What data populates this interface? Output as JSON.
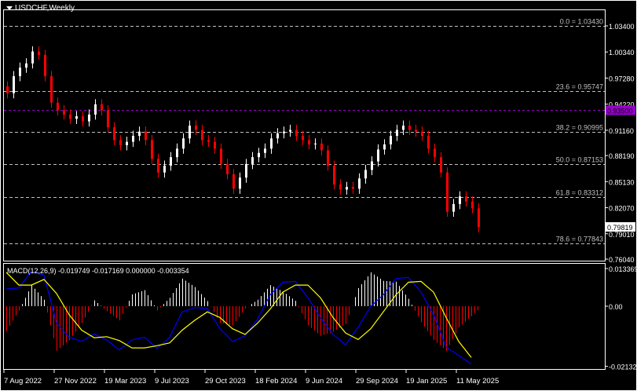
{
  "header": {
    "symbol_timeframe": "USDCHF,Weekly",
    "menu_icon": "triangle-down-icon"
  },
  "colors": {
    "bull": "#ffffff",
    "bear": "#ff0000",
    "macd": "#0000ff",
    "signal": "#ffff00",
    "hist_pos": "#ffffff",
    "hist_neg": "#ff0000",
    "horizontal_line": "#9900cc",
    "fib": "#c0c0c0"
  },
  "price_axis": {
    "ticks": [
      "1.03400",
      "1.00340",
      "0.97280",
      "0.94220",
      "0.91160",
      "0.88190",
      "0.85130",
      "0.82070",
      "0.79010",
      "0.76040"
    ],
    "range": [
      0.7604,
      1.034
    ]
  },
  "current_price": "0.79819",
  "horizontal_line": {
    "value": 0.935,
    "label": "0.93500"
  },
  "fibonacci": [
    {
      "level": "0.0",
      "value": 1.0343,
      "label": "0.0 = 1.03430"
    },
    {
      "level": "23.6",
      "value": 0.95747,
      "label": "23.6 = 0.95747"
    },
    {
      "level": "38.2",
      "value": 0.90995,
      "label": "38.2 = 0.90995"
    },
    {
      "level": "50.0",
      "value": 0.87153,
      "label": "50.0 = 0.87153"
    },
    {
      "level": "61.8",
      "value": 0.83312,
      "label": "61.8 = 0.83312"
    },
    {
      "level": "78.6",
      "value": 0.77843,
      "label": "78.6 = 0.77843"
    }
  ],
  "time_axis": [
    "7 Aug 2022",
    "27 Nov 2022",
    "19 Mar 2023",
    "9 Jul 2023",
    "29 Oct 2023",
    "18 Feb 2024",
    "9 Jun 2024",
    "29 Sep 2024",
    "19 Jan 2025",
    "11 May 2025"
  ],
  "macd_panel": {
    "label": "MACD(12,26,9) -0.019749 -0.017169 0.000000 -0.003354",
    "axis_ticks": [
      "0.013369",
      "0.00",
      "-0.021326"
    ],
    "range": [
      -0.021326,
      0.013369
    ]
  },
  "chart_data": {
    "type": "candlestick",
    "title": "USDCHF,Weekly",
    "closes": [
      0.955,
      0.975,
      0.985,
      0.99,
      1.004,
      1.0,
      0.975,
      0.944,
      0.935,
      0.93,
      0.925,
      0.928,
      0.922,
      0.93,
      0.942,
      0.935,
      0.915,
      0.9,
      0.894,
      0.898,
      0.905,
      0.91,
      0.9,
      0.878,
      0.862,
      0.87,
      0.88,
      0.89,
      0.902,
      0.917,
      0.912,
      0.9,
      0.898,
      0.89,
      0.872,
      0.86,
      0.843,
      0.856,
      0.872,
      0.88,
      0.885,
      0.89,
      0.902,
      0.908,
      0.91,
      0.912,
      0.905,
      0.9,
      0.895,
      0.896,
      0.888,
      0.87,
      0.848,
      0.842,
      0.845,
      0.843,
      0.855,
      0.865,
      0.875,
      0.889,
      0.895,
      0.905,
      0.912,
      0.917,
      0.912,
      0.91,
      0.905,
      0.89,
      0.88,
      0.862,
      0.816,
      0.825,
      0.834,
      0.828,
      0.82,
      0.798
    ],
    "macd": [
      0.0061,
      0.0065,
      0.0125,
      0.011,
      -0.006,
      -0.011,
      -0.0125,
      -0.0098,
      -0.012,
      -0.0155,
      -0.012,
      -0.011,
      -0.015,
      -0.011,
      -0.002,
      -0.0005,
      -0.0008,
      -0.008,
      -0.0125,
      -0.0105,
      -0.0045,
      0.004,
      0.0085,
      0.0088,
      0.003,
      -0.004,
      -0.01,
      -0.0137,
      -0.0075,
      0.0,
      0.004,
      0.0098,
      0.0102,
      0.005,
      -0.003,
      -0.0145,
      -0.0175,
      -0.0205
    ],
    "signal": [
      0.012,
      0.0075,
      0.0075,
      0.0095,
      0.0045,
      -0.003,
      -0.0085,
      -0.0112,
      -0.0108,
      -0.0122,
      -0.0148,
      -0.0148,
      -0.014,
      -0.013,
      -0.0085,
      -0.005,
      -0.002,
      -0.004,
      -0.008,
      -0.01,
      -0.006,
      -0.001,
      0.005,
      0.0075,
      0.0075,
      0.003,
      -0.004,
      -0.0095,
      -0.0118,
      -0.008,
      -0.002,
      0.004,
      0.0085,
      0.0088,
      0.005,
      -0.004,
      -0.0125,
      -0.0182
    ],
    "histogram": [
      -0.0088,
      -0.0015,
      0.0075,
      0.0023,
      -0.0158,
      -0.012,
      -0.006,
      0.0021,
      -0.0018,
      -0.005,
      0.0042,
      0.0057,
      -0.0015,
      0.003,
      0.0098,
      0.0068,
      0.0018,
      -0.006,
      -0.0068,
      -0.0008,
      0.0023,
      0.0075,
      0.0052,
      0.0019,
      -0.0068,
      -0.0105,
      -0.009,
      -0.0063,
      0.0064,
      0.012,
      0.009,
      0.0087,
      0.0026,
      -0.0057,
      -0.012,
      -0.0158,
      -0.0075,
      -0.0035
    ]
  }
}
